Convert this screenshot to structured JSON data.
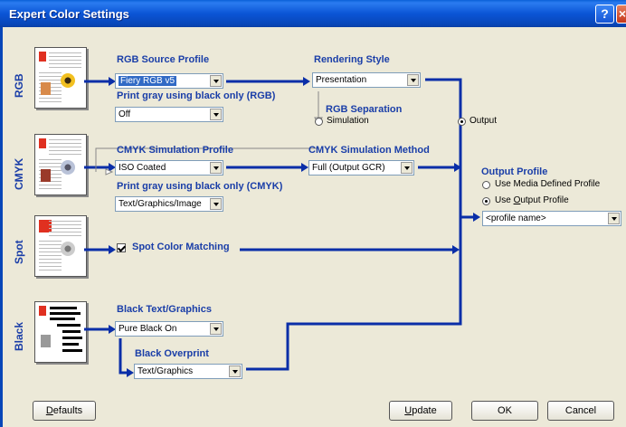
{
  "window": {
    "title": "Expert Color Settings"
  },
  "rows": {
    "rgb": "RGB",
    "cmyk": "CMYK",
    "spot": "Spot",
    "black": "Black"
  },
  "rgb": {
    "source_profile_label": "RGB Source Profile",
    "source_profile_value": "Fiery RGB v5",
    "print_gray_label": "Print gray using black only (RGB)",
    "print_gray_value": "Off",
    "rendering_style_label": "Rendering Style",
    "rendering_style_value": "Presentation",
    "separation_label": "RGB Separation",
    "separation_simulation": "Simulation",
    "separation_output": "Output"
  },
  "cmyk": {
    "simulation_profile_label": "CMYK Simulation Profile",
    "simulation_profile_value": "ISO Coated",
    "simulation_method_label": "CMYK Simulation Method",
    "simulation_method_value": "Full (Output GCR)",
    "print_gray_label": "Print gray using black only (CMYK)",
    "print_gray_value": "Text/Graphics/Image"
  },
  "output": {
    "label": "Output Profile",
    "use_media_defined": "Use Media Defined Profile",
    "use_output_profile_prefix": "Use ",
    "use_output_profile_accel": "O",
    "use_output_profile_rest": "utput Profile",
    "profile_name": "<profile name>"
  },
  "spot": {
    "matching_label": "Spot Color Matching"
  },
  "black": {
    "text_graphics_label": "Black Text/Graphics",
    "text_graphics_value": "Pure Black On",
    "overprint_label": "Black Overprint",
    "overprint_value": "Text/Graphics"
  },
  "buttons": {
    "defaults_accel": "D",
    "defaults_rest": "efaults",
    "update_accel": "U",
    "update_rest": "pdate",
    "ok": "OK",
    "cancel": "Cancel"
  },
  "colors": {
    "flow": "#0a2ea8",
    "label": "#1a3ea8",
    "titlebar": "#0b55d6"
  }
}
